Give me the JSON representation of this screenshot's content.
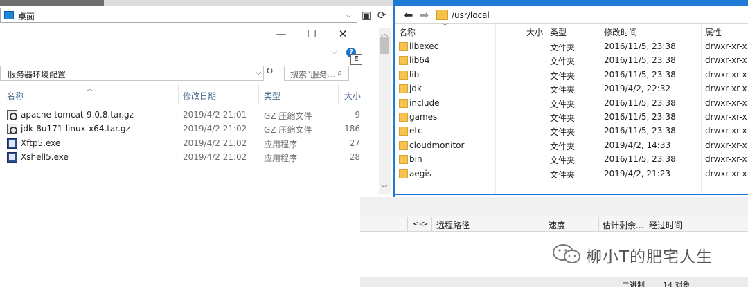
{
  "local": {
    "drive_label": "桌面",
    "address": "服务器环境配置",
    "search_placeholder": "搜索\"服务...",
    "help_letter": "E",
    "columns": {
      "name": "名称",
      "date": "修改日期",
      "type": "类型",
      "size": "大小"
    },
    "files": [
      {
        "name": "apache-tomcat-9.0.8.tar.gz",
        "date": "2019/4/2 21:01",
        "type": "GZ 压缩文件",
        "size": "9",
        "icon": "archive-icon"
      },
      {
        "name": "jdk-8u171-linux-x64.tar.gz",
        "date": "2019/4/2 21:02",
        "type": "GZ 压缩文件",
        "size": "186",
        "icon": "archive-icon"
      },
      {
        "name": "Xftp5.exe",
        "date": "2019/4/2 21:02",
        "type": "应用程序",
        "size": "27",
        "icon": "exe-icon"
      },
      {
        "name": "Xshell5.exe",
        "date": "2019/4/2 21:02",
        "type": "应用程序",
        "size": "28",
        "icon": "exe-icon"
      }
    ]
  },
  "remote": {
    "path": "/usr/local",
    "columns": {
      "name": "名称",
      "size": "大小",
      "type": "类型",
      "time": "修改时间",
      "perm": "属性"
    },
    "files": [
      {
        "name": "libexec",
        "type": "文件夹",
        "time": "2016/11/5, 23:38",
        "perm": "drwxr-xr-x"
      },
      {
        "name": "lib64",
        "type": "文件夹",
        "time": "2016/11/5, 23:38",
        "perm": "drwxr-xr-x"
      },
      {
        "name": "lib",
        "type": "文件夹",
        "time": "2016/11/5, 23:38",
        "perm": "drwxr-xr-x"
      },
      {
        "name": "jdk",
        "type": "文件夹",
        "time": "2019/4/2, 22:32",
        "perm": "drwxr-xr-x"
      },
      {
        "name": "include",
        "type": "文件夹",
        "time": "2016/11/5, 23:38",
        "perm": "drwxr-xr-x"
      },
      {
        "name": "games",
        "type": "文件夹",
        "time": "2016/11/5, 23:38",
        "perm": "drwxr-xr-x"
      },
      {
        "name": "etc",
        "type": "文件夹",
        "time": "2016/11/5, 23:38",
        "perm": "drwxr-xr-x"
      },
      {
        "name": "cloudmonitor",
        "type": "文件夹",
        "time": "2019/4/2, 14:33",
        "perm": "drwxr-xr-x"
      },
      {
        "name": "bin",
        "type": "文件夹",
        "time": "2016/11/5, 23:38",
        "perm": "drwxr-xr-x"
      },
      {
        "name": "aegis",
        "type": "文件夹",
        "time": "2019/4/2, 21:23",
        "perm": "drwxr-xr-x"
      }
    ]
  },
  "transfer": {
    "direction": "<->",
    "remote_path": "远程路径",
    "speed": "速度",
    "eta": "估计剩余...",
    "elapsed": "经过时间"
  },
  "watermark": "柳小T的肥宅人生",
  "status": {
    "encoding": "二进制",
    "count": "14 对象"
  },
  "colors": {
    "accent": "#1e7ad4",
    "folder": "#f6c34f"
  }
}
